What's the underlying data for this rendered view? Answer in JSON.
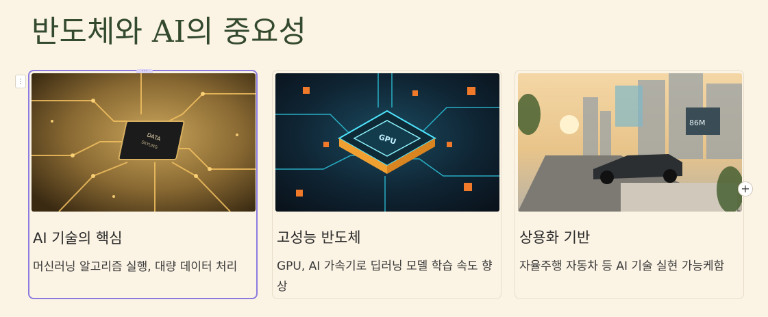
{
  "page": {
    "title": "반도체와 AI의 중요성"
  },
  "cards": [
    {
      "image_icon": "circuit-chip-image",
      "chip_label_1": "DATA",
      "chip_label_2": "SKYUNG",
      "heading": "AI 기술의 핵심",
      "description": "머신러닝 알고리즘 실행, 대량 데이터 처리"
    },
    {
      "image_icon": "gpu-chip-image",
      "chip_label_1": "GPU",
      "heading": "고성능 반도체",
      "description": "GPU, AI 가속기로 딥러닝 모델 학습 속도 향상"
    },
    {
      "image_icon": "autonomous-car-city-image",
      "screen_label": "86M",
      "heading": "상용화 기반",
      "description": "자율주행 자동차 등 AI 기술 실현 가능케함"
    }
  ],
  "controls": {
    "drag_handle": "⋮",
    "card_menu": "···",
    "add_symbol": "+"
  },
  "colors": {
    "background": "#fbf3e4",
    "title": "#344a2e",
    "selection": "#8b7be0"
  }
}
